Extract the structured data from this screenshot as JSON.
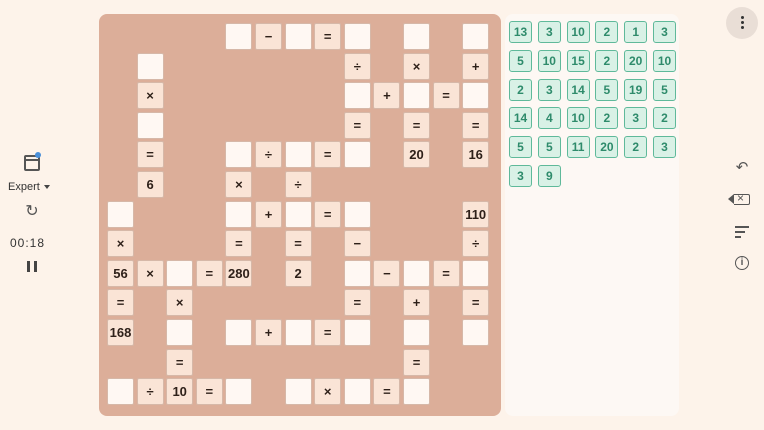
{
  "left": {
    "difficulty": "Expert",
    "timer": "00:18",
    "icons": [
      "calendar-icon",
      "refresh-icon",
      "pause-icon"
    ]
  },
  "board": {
    "cells": [
      {
        "r": 0,
        "c": 4,
        "t": "empty",
        "v": ""
      },
      {
        "r": 0,
        "c": 5,
        "t": "op",
        "v": "−"
      },
      {
        "r": 0,
        "c": 6,
        "t": "empty",
        "v": ""
      },
      {
        "r": 0,
        "c": 7,
        "t": "op",
        "v": "="
      },
      {
        "r": 0,
        "c": 8,
        "t": "empty",
        "v": ""
      },
      {
        "r": 0,
        "c": 10,
        "t": "empty",
        "v": ""
      },
      {
        "r": 0,
        "c": 12,
        "t": "empty",
        "v": ""
      },
      {
        "r": 1,
        "c": 1,
        "t": "empty",
        "v": ""
      },
      {
        "r": 1,
        "c": 8,
        "t": "op",
        "v": "÷"
      },
      {
        "r": 1,
        "c": 10,
        "t": "op",
        "v": "×"
      },
      {
        "r": 1,
        "c": 12,
        "t": "op",
        "v": "+"
      },
      {
        "r": 2,
        "c": 1,
        "t": "op",
        "v": "×"
      },
      {
        "r": 2,
        "c": 8,
        "t": "empty",
        "v": ""
      },
      {
        "r": 2,
        "c": 9,
        "t": "op",
        "v": "+"
      },
      {
        "r": 2,
        "c": 10,
        "t": "empty",
        "v": ""
      },
      {
        "r": 2,
        "c": 11,
        "t": "op",
        "v": "="
      },
      {
        "r": 2,
        "c": 12,
        "t": "empty",
        "v": ""
      },
      {
        "r": 3,
        "c": 1,
        "t": "empty",
        "v": ""
      },
      {
        "r": 3,
        "c": 8,
        "t": "op",
        "v": "="
      },
      {
        "r": 3,
        "c": 10,
        "t": "op",
        "v": "="
      },
      {
        "r": 3,
        "c": 12,
        "t": "op",
        "v": "="
      },
      {
        "r": 4,
        "c": 1,
        "t": "op",
        "v": "="
      },
      {
        "r": 4,
        "c": 4,
        "t": "empty",
        "v": ""
      },
      {
        "r": 4,
        "c": 5,
        "t": "op",
        "v": "÷"
      },
      {
        "r": 4,
        "c": 6,
        "t": "empty",
        "v": ""
      },
      {
        "r": 4,
        "c": 7,
        "t": "op",
        "v": "="
      },
      {
        "r": 4,
        "c": 8,
        "t": "empty",
        "v": ""
      },
      {
        "r": 4,
        "c": 10,
        "t": "num",
        "v": "20"
      },
      {
        "r": 4,
        "c": 12,
        "t": "num",
        "v": "16"
      },
      {
        "r": 5,
        "c": 1,
        "t": "num",
        "v": "6"
      },
      {
        "r": 5,
        "c": 4,
        "t": "op",
        "v": "×"
      },
      {
        "r": 5,
        "c": 6,
        "t": "op",
        "v": "÷"
      },
      {
        "r": 6,
        "c": 0,
        "t": "empty",
        "v": ""
      },
      {
        "r": 6,
        "c": 4,
        "t": "empty",
        "v": ""
      },
      {
        "r": 6,
        "c": 5,
        "t": "op",
        "v": "+"
      },
      {
        "r": 6,
        "c": 6,
        "t": "empty",
        "v": ""
      },
      {
        "r": 6,
        "c": 7,
        "t": "op",
        "v": "="
      },
      {
        "r": 6,
        "c": 8,
        "t": "empty",
        "v": ""
      },
      {
        "r": 6,
        "c": 12,
        "t": "num",
        "v": "110"
      },
      {
        "r": 7,
        "c": 0,
        "t": "op",
        "v": "×"
      },
      {
        "r": 7,
        "c": 4,
        "t": "op",
        "v": "="
      },
      {
        "r": 7,
        "c": 6,
        "t": "op",
        "v": "="
      },
      {
        "r": 7,
        "c": 8,
        "t": "op",
        "v": "−"
      },
      {
        "r": 7,
        "c": 12,
        "t": "op",
        "v": "÷"
      },
      {
        "r": 8,
        "c": 0,
        "t": "num",
        "v": "56"
      },
      {
        "r": 8,
        "c": 1,
        "t": "op",
        "v": "×"
      },
      {
        "r": 8,
        "c": 2,
        "t": "empty",
        "v": ""
      },
      {
        "r": 8,
        "c": 3,
        "t": "op",
        "v": "="
      },
      {
        "r": 8,
        "c": 4,
        "t": "num",
        "v": "280"
      },
      {
        "r": 8,
        "c": 6,
        "t": "num",
        "v": "2"
      },
      {
        "r": 8,
        "c": 8,
        "t": "empty",
        "v": ""
      },
      {
        "r": 8,
        "c": 9,
        "t": "op",
        "v": "−"
      },
      {
        "r": 8,
        "c": 10,
        "t": "empty",
        "v": ""
      },
      {
        "r": 8,
        "c": 11,
        "t": "op",
        "v": "="
      },
      {
        "r": 8,
        "c": 12,
        "t": "empty",
        "v": ""
      },
      {
        "r": 9,
        "c": 0,
        "t": "op",
        "v": "="
      },
      {
        "r": 9,
        "c": 2,
        "t": "op",
        "v": "×"
      },
      {
        "r": 9,
        "c": 8,
        "t": "op",
        "v": "="
      },
      {
        "r": 9,
        "c": 10,
        "t": "op",
        "v": "+"
      },
      {
        "r": 9,
        "c": 12,
        "t": "op",
        "v": "="
      },
      {
        "r": 10,
        "c": 0,
        "t": "num",
        "v": "168"
      },
      {
        "r": 10,
        "c": 2,
        "t": "empty",
        "v": ""
      },
      {
        "r": 10,
        "c": 4,
        "t": "empty",
        "v": ""
      },
      {
        "r": 10,
        "c": 5,
        "t": "op",
        "v": "+"
      },
      {
        "r": 10,
        "c": 6,
        "t": "empty",
        "v": ""
      },
      {
        "r": 10,
        "c": 7,
        "t": "op",
        "v": "="
      },
      {
        "r": 10,
        "c": 8,
        "t": "empty",
        "v": ""
      },
      {
        "r": 10,
        "c": 10,
        "t": "empty",
        "v": ""
      },
      {
        "r": 10,
        "c": 12,
        "t": "empty",
        "v": ""
      },
      {
        "r": 11,
        "c": 2,
        "t": "op",
        "v": "="
      },
      {
        "r": 11,
        "c": 10,
        "t": "op",
        "v": "="
      },
      {
        "r": 12,
        "c": 0,
        "t": "empty",
        "v": ""
      },
      {
        "r": 12,
        "c": 1,
        "t": "op",
        "v": "÷"
      },
      {
        "r": 12,
        "c": 2,
        "t": "num",
        "v": "10"
      },
      {
        "r": 12,
        "c": 3,
        "t": "op",
        "v": "="
      },
      {
        "r": 12,
        "c": 4,
        "t": "empty",
        "v": ""
      },
      {
        "r": 12,
        "c": 6,
        "t": "empty",
        "v": ""
      },
      {
        "r": 12,
        "c": 7,
        "t": "op",
        "v": "×"
      },
      {
        "r": 12,
        "c": 8,
        "t": "empty",
        "v": ""
      },
      {
        "r": 12,
        "c": 9,
        "t": "op",
        "v": "="
      },
      {
        "r": 12,
        "c": 10,
        "t": "empty",
        "v": ""
      }
    ]
  },
  "tiles": [
    "13",
    "3",
    "10",
    "2",
    "1",
    "3",
    "5",
    "10",
    "15",
    "2",
    "20",
    "10",
    "2",
    "3",
    "14",
    "5",
    "19",
    "5",
    "14",
    "4",
    "10",
    "2",
    "3",
    "2",
    "5",
    "5",
    "11",
    "20",
    "2",
    "3",
    "3",
    "9"
  ],
  "right": {
    "icons": [
      "more-vert-icon",
      "undo-icon",
      "backspace-icon",
      "sort-icon",
      "info-icon"
    ]
  },
  "colors": {
    "background": "#fdf3ea",
    "board": "#dcae99",
    "tile_bg": "#d9f1e6",
    "tile_text": "#2e8b6b"
  }
}
